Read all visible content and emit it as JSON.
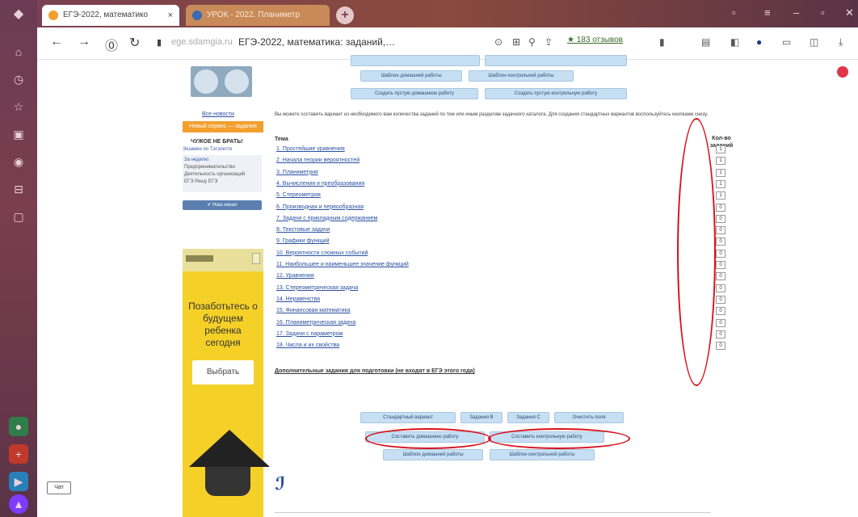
{
  "browser": {
    "tabs": [
      {
        "label": "ЕГЭ-2022, математико",
        "close": "×",
        "favicon_color": "#f29f2e"
      },
      {
        "label": "УРОК - 2022. Планиметр",
        "favicon_color": "#3a6bb0"
      }
    ],
    "new_tab": "+",
    "url_host": "ege.sdamgia.ru",
    "page_title": "ЕГЭ-2022, математика: заданий,…",
    "reviews": "★ 183 отзывов"
  },
  "sidebar": {
    "all_news": "Все новости",
    "orange_button": "Новый сервис — задания",
    "heading": "ЧУЖОЕ НЕ БРАТЬ!",
    "subheading": "Экзамен по Тэтэпетте",
    "card_lines": [
      "За неделю:",
      "Предпринимательство",
      "Деятельность организаций",
      "ЕГЭ Решу ЕГЭ"
    ],
    "vk_button": "Наш канал",
    "ad": {
      "text": "Позаботьтесь о будущем ребенка сегодня",
      "button": "Выбрать"
    }
  },
  "main": {
    "top_buttons": [
      "Шаблон домашней работы",
      "Шаблон контрольной работы",
      "Создать пустую домашнюю работу",
      "Создать пустую контрольную работу"
    ],
    "info_text": "Вы можете составить вариант из необходимого вам количества заданий по тем или иным разделам задачного каталога. Для создания стандартных вариантов воспользуйтесь кнопками снизу.",
    "col_topic": "Тема",
    "col_count_1": "Кол-во",
    "col_count_2": "заданий",
    "topics": [
      {
        "label": "1. Простейшие уравнения",
        "count": "1"
      },
      {
        "label": "2. Начала теории вероятностей",
        "count": "1"
      },
      {
        "label": "3. Планиметрия",
        "count": "1"
      },
      {
        "label": "4. Вычисления и преобразования",
        "count": "1"
      },
      {
        "label": "5. Стереометрия",
        "count": "1"
      },
      {
        "label": "6. Производная и первообразная",
        "count": "0"
      },
      {
        "label": "7. Задачи с прикладным содержанием",
        "count": "0"
      },
      {
        "label": "8. Текстовые задачи",
        "count": "0"
      },
      {
        "label": "9. Графики функций",
        "count": "0"
      },
      {
        "label": "10. Вероятности сложных событий",
        "count": "0"
      },
      {
        "label": "11. Наибольшее и наименьшее значение функций",
        "count": "0"
      },
      {
        "label": "12. Уравнения",
        "count": "0"
      },
      {
        "label": "13. Стереометрическая задача",
        "count": "0"
      },
      {
        "label": "14. Неравенства",
        "count": "0"
      },
      {
        "label": "15. Финансовая математика",
        "count": "0"
      },
      {
        "label": "16. Планиметрическая задача",
        "count": "0"
      },
      {
        "label": "17. Задачи с параметром",
        "count": "0"
      },
      {
        "label": "18. Числа и их свойства",
        "count": "0"
      }
    ],
    "extra_link": "Дополнительные задания для подготовки (не входят в ЕГЭ этого года)",
    "bottom_row1": [
      "Стандартный вариант",
      "Задания B",
      "Задания C",
      "Очистить поля"
    ],
    "bottom_row2": [
      "Составить домашнюю работу",
      "Составить контрольную работу"
    ],
    "bottom_row3": [
      "Шаблон домашней работы",
      "Шаблон контрольной работы"
    ]
  },
  "chat_button": "Чат",
  "colors": {
    "annotation_red": "#d8101c",
    "button_blue": "#c7dff3",
    "link_blue": "#2a4fa0"
  }
}
